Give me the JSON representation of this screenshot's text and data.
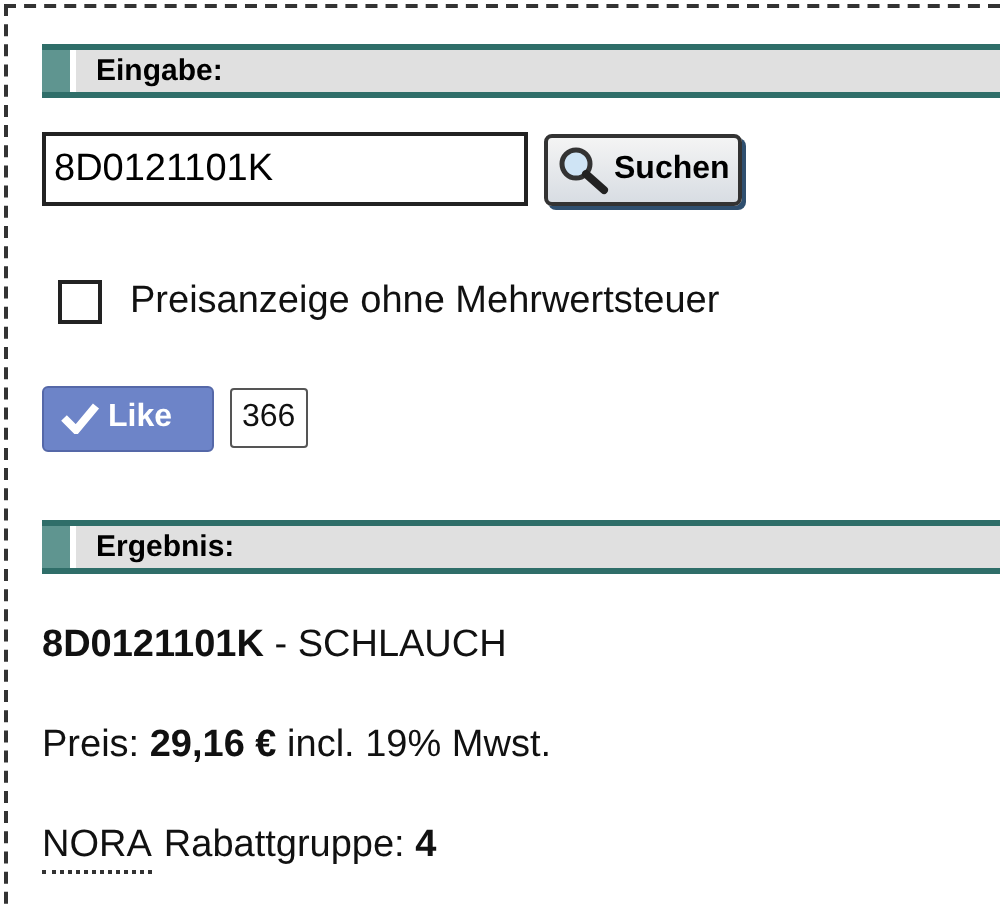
{
  "input_section": {
    "title": "Eingabe:",
    "search": {
      "value": "8D0121101K"
    },
    "search_button": "Suchen",
    "vat_checkbox": {
      "label": "Preisanzeige ohne Mehrwertsteuer",
      "checked": false
    },
    "like": {
      "label": "Like",
      "count": "366"
    }
  },
  "result_section": {
    "title": "Ergebnis:",
    "part_line": "**8D0121101K** - SCHLAUCH",
    "price_line": "Preis: **29,16 €** incl. 19% Mwst.",
    "discount": {
      "abbr": "NORA",
      "text": "Rabattgruppe: **4**"
    }
  }
}
